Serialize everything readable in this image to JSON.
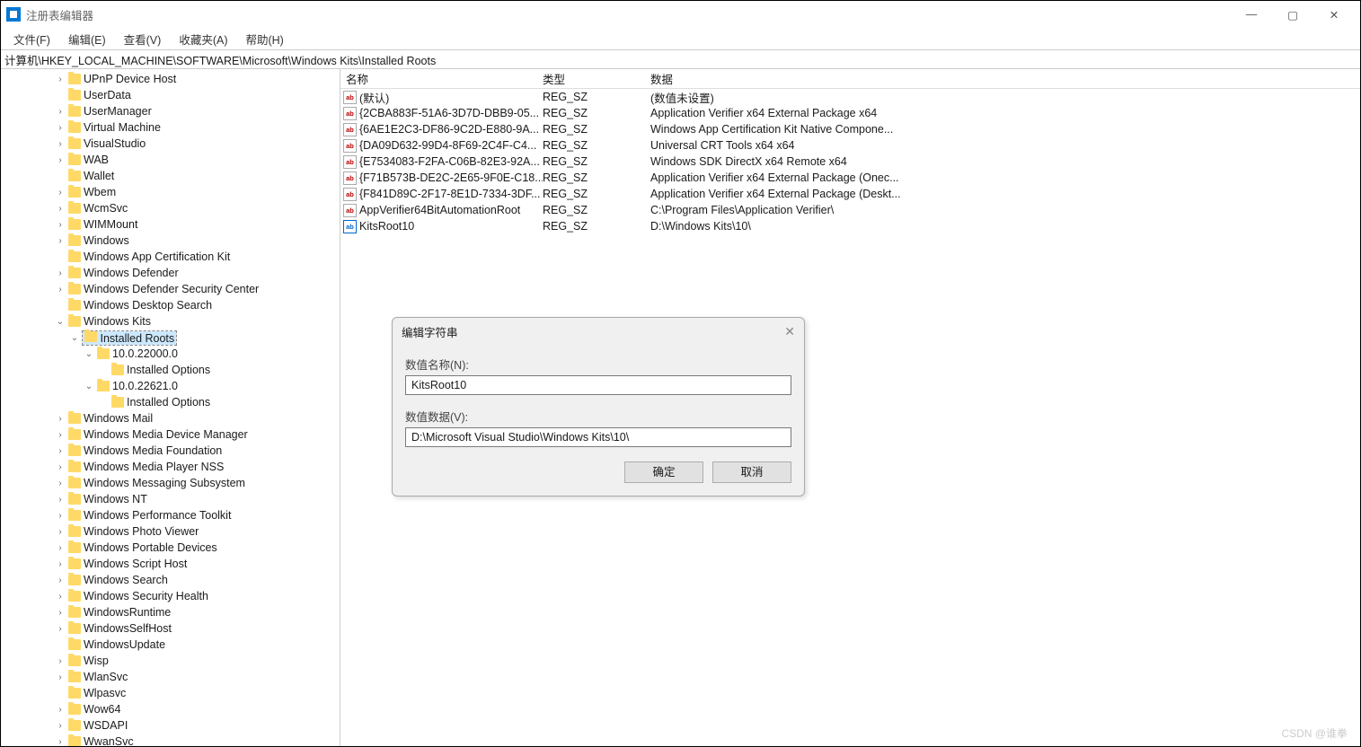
{
  "window": {
    "title": "注册表编辑器"
  },
  "menu": {
    "file": "文件(F)",
    "edit": "编辑(E)",
    "view": "查看(V)",
    "favorites": "收藏夹(A)",
    "help": "帮助(H)"
  },
  "address": "计算机\\HKEY_LOCAL_MACHINE\\SOFTWARE\\Microsoft\\Windows Kits\\Installed Roots",
  "tree": [
    {
      "l": 0,
      "c": ">",
      "t": "UPnP Device Host"
    },
    {
      "l": 0,
      "c": "",
      "t": "UserData"
    },
    {
      "l": 0,
      "c": ">",
      "t": "UserManager"
    },
    {
      "l": 0,
      "c": ">",
      "t": "Virtual Machine"
    },
    {
      "l": 0,
      "c": ">",
      "t": "VisualStudio"
    },
    {
      "l": 0,
      "c": ">",
      "t": "WAB"
    },
    {
      "l": 0,
      "c": "",
      "t": "Wallet"
    },
    {
      "l": 0,
      "c": ">",
      "t": "Wbem"
    },
    {
      "l": 0,
      "c": ">",
      "t": "WcmSvc"
    },
    {
      "l": 0,
      "c": ">",
      "t": "WIMMount"
    },
    {
      "l": 0,
      "c": ">",
      "t": "Windows"
    },
    {
      "l": 0,
      "c": "",
      "t": "Windows App Certification Kit"
    },
    {
      "l": 0,
      "c": ">",
      "t": "Windows Defender"
    },
    {
      "l": 0,
      "c": ">",
      "t": "Windows Defender Security Center"
    },
    {
      "l": 0,
      "c": "",
      "t": "Windows Desktop Search"
    },
    {
      "l": 0,
      "c": "v",
      "t": "Windows Kits"
    },
    {
      "l": 1,
      "c": "v",
      "t": "Installed Roots",
      "sel": true
    },
    {
      "l": 2,
      "c": "v",
      "t": "10.0.22000.0"
    },
    {
      "l": 3,
      "c": "",
      "t": "Installed Options"
    },
    {
      "l": 2,
      "c": "v",
      "t": "10.0.22621.0"
    },
    {
      "l": 3,
      "c": "",
      "t": "Installed Options"
    },
    {
      "l": 0,
      "c": ">",
      "t": "Windows Mail"
    },
    {
      "l": 0,
      "c": ">",
      "t": "Windows Media Device Manager"
    },
    {
      "l": 0,
      "c": ">",
      "t": "Windows Media Foundation"
    },
    {
      "l": 0,
      "c": ">",
      "t": "Windows Media Player NSS"
    },
    {
      "l": 0,
      "c": ">",
      "t": "Windows Messaging Subsystem"
    },
    {
      "l": 0,
      "c": ">",
      "t": "Windows NT"
    },
    {
      "l": 0,
      "c": ">",
      "t": "Windows Performance Toolkit"
    },
    {
      "l": 0,
      "c": ">",
      "t": "Windows Photo Viewer"
    },
    {
      "l": 0,
      "c": ">",
      "t": "Windows Portable Devices"
    },
    {
      "l": 0,
      "c": ">",
      "t": "Windows Script Host"
    },
    {
      "l": 0,
      "c": ">",
      "t": "Windows Search"
    },
    {
      "l": 0,
      "c": ">",
      "t": "Windows Security Health"
    },
    {
      "l": 0,
      "c": ">",
      "t": "WindowsRuntime"
    },
    {
      "l": 0,
      "c": ">",
      "t": "WindowsSelfHost"
    },
    {
      "l": 0,
      "c": "",
      "t": "WindowsUpdate"
    },
    {
      "l": 0,
      "c": ">",
      "t": "Wisp"
    },
    {
      "l": 0,
      "c": ">",
      "t": "WlanSvc"
    },
    {
      "l": 0,
      "c": "",
      "t": "Wlpasvc"
    },
    {
      "l": 0,
      "c": ">",
      "t": "Wow64"
    },
    {
      "l": 0,
      "c": ">",
      "t": "WSDAPI"
    },
    {
      "l": 0,
      "c": ">",
      "t": "WwanSvc"
    }
  ],
  "columns": {
    "name": "名称",
    "type": "类型",
    "data": "数据"
  },
  "rows": [
    {
      "icon": "ab",
      "name": "(默认)",
      "type": "REG_SZ",
      "data": "(数值未设置)"
    },
    {
      "icon": "ab",
      "name": "{2CBA883F-51A6-3D7D-DBB9-05...",
      "type": "REG_SZ",
      "data": "Application Verifier x64 External Package x64"
    },
    {
      "icon": "ab",
      "name": "{6AE1E2C3-DF86-9C2D-E880-9A...",
      "type": "REG_SZ",
      "data": "Windows App Certification Kit Native Compone..."
    },
    {
      "icon": "ab",
      "name": "{DA09D632-99D4-8F69-2C4F-C4...",
      "type": "REG_SZ",
      "data": "Universal CRT Tools x64 x64"
    },
    {
      "icon": "ab",
      "name": "{E7534083-F2FA-C06B-82E3-92A...",
      "type": "REG_SZ",
      "data": "Windows SDK DirectX x64 Remote x64"
    },
    {
      "icon": "ab",
      "name": "{F71B573B-DE2C-2E65-9F0E-C18...",
      "type": "REG_SZ",
      "data": "Application Verifier x64 External Package (Onec..."
    },
    {
      "icon": "ab",
      "name": "{F841D89C-2F17-8E1D-7334-3DF...",
      "type": "REG_SZ",
      "data": "Application Verifier x64 External Package (Deskt..."
    },
    {
      "icon": "ab",
      "name": "AppVerifier64BitAutomationRoot",
      "type": "REG_SZ",
      "data": "C:\\Program Files\\Application Verifier\\"
    },
    {
      "icon": "ab-blue",
      "name": "KitsRoot10",
      "type": "REG_SZ",
      "data": "D:\\Windows Kits\\10\\"
    }
  ],
  "dialog": {
    "title": "编辑字符串",
    "name_label": "数值名称(N):",
    "name_value": "KitsRoot10",
    "data_label": "数值数据(V):",
    "data_value": "D:\\Microsoft Visual Studio\\Windows Kits\\10\\",
    "ok": "确定",
    "cancel": "取消"
  },
  "watermark": "CSDN @谁拳"
}
